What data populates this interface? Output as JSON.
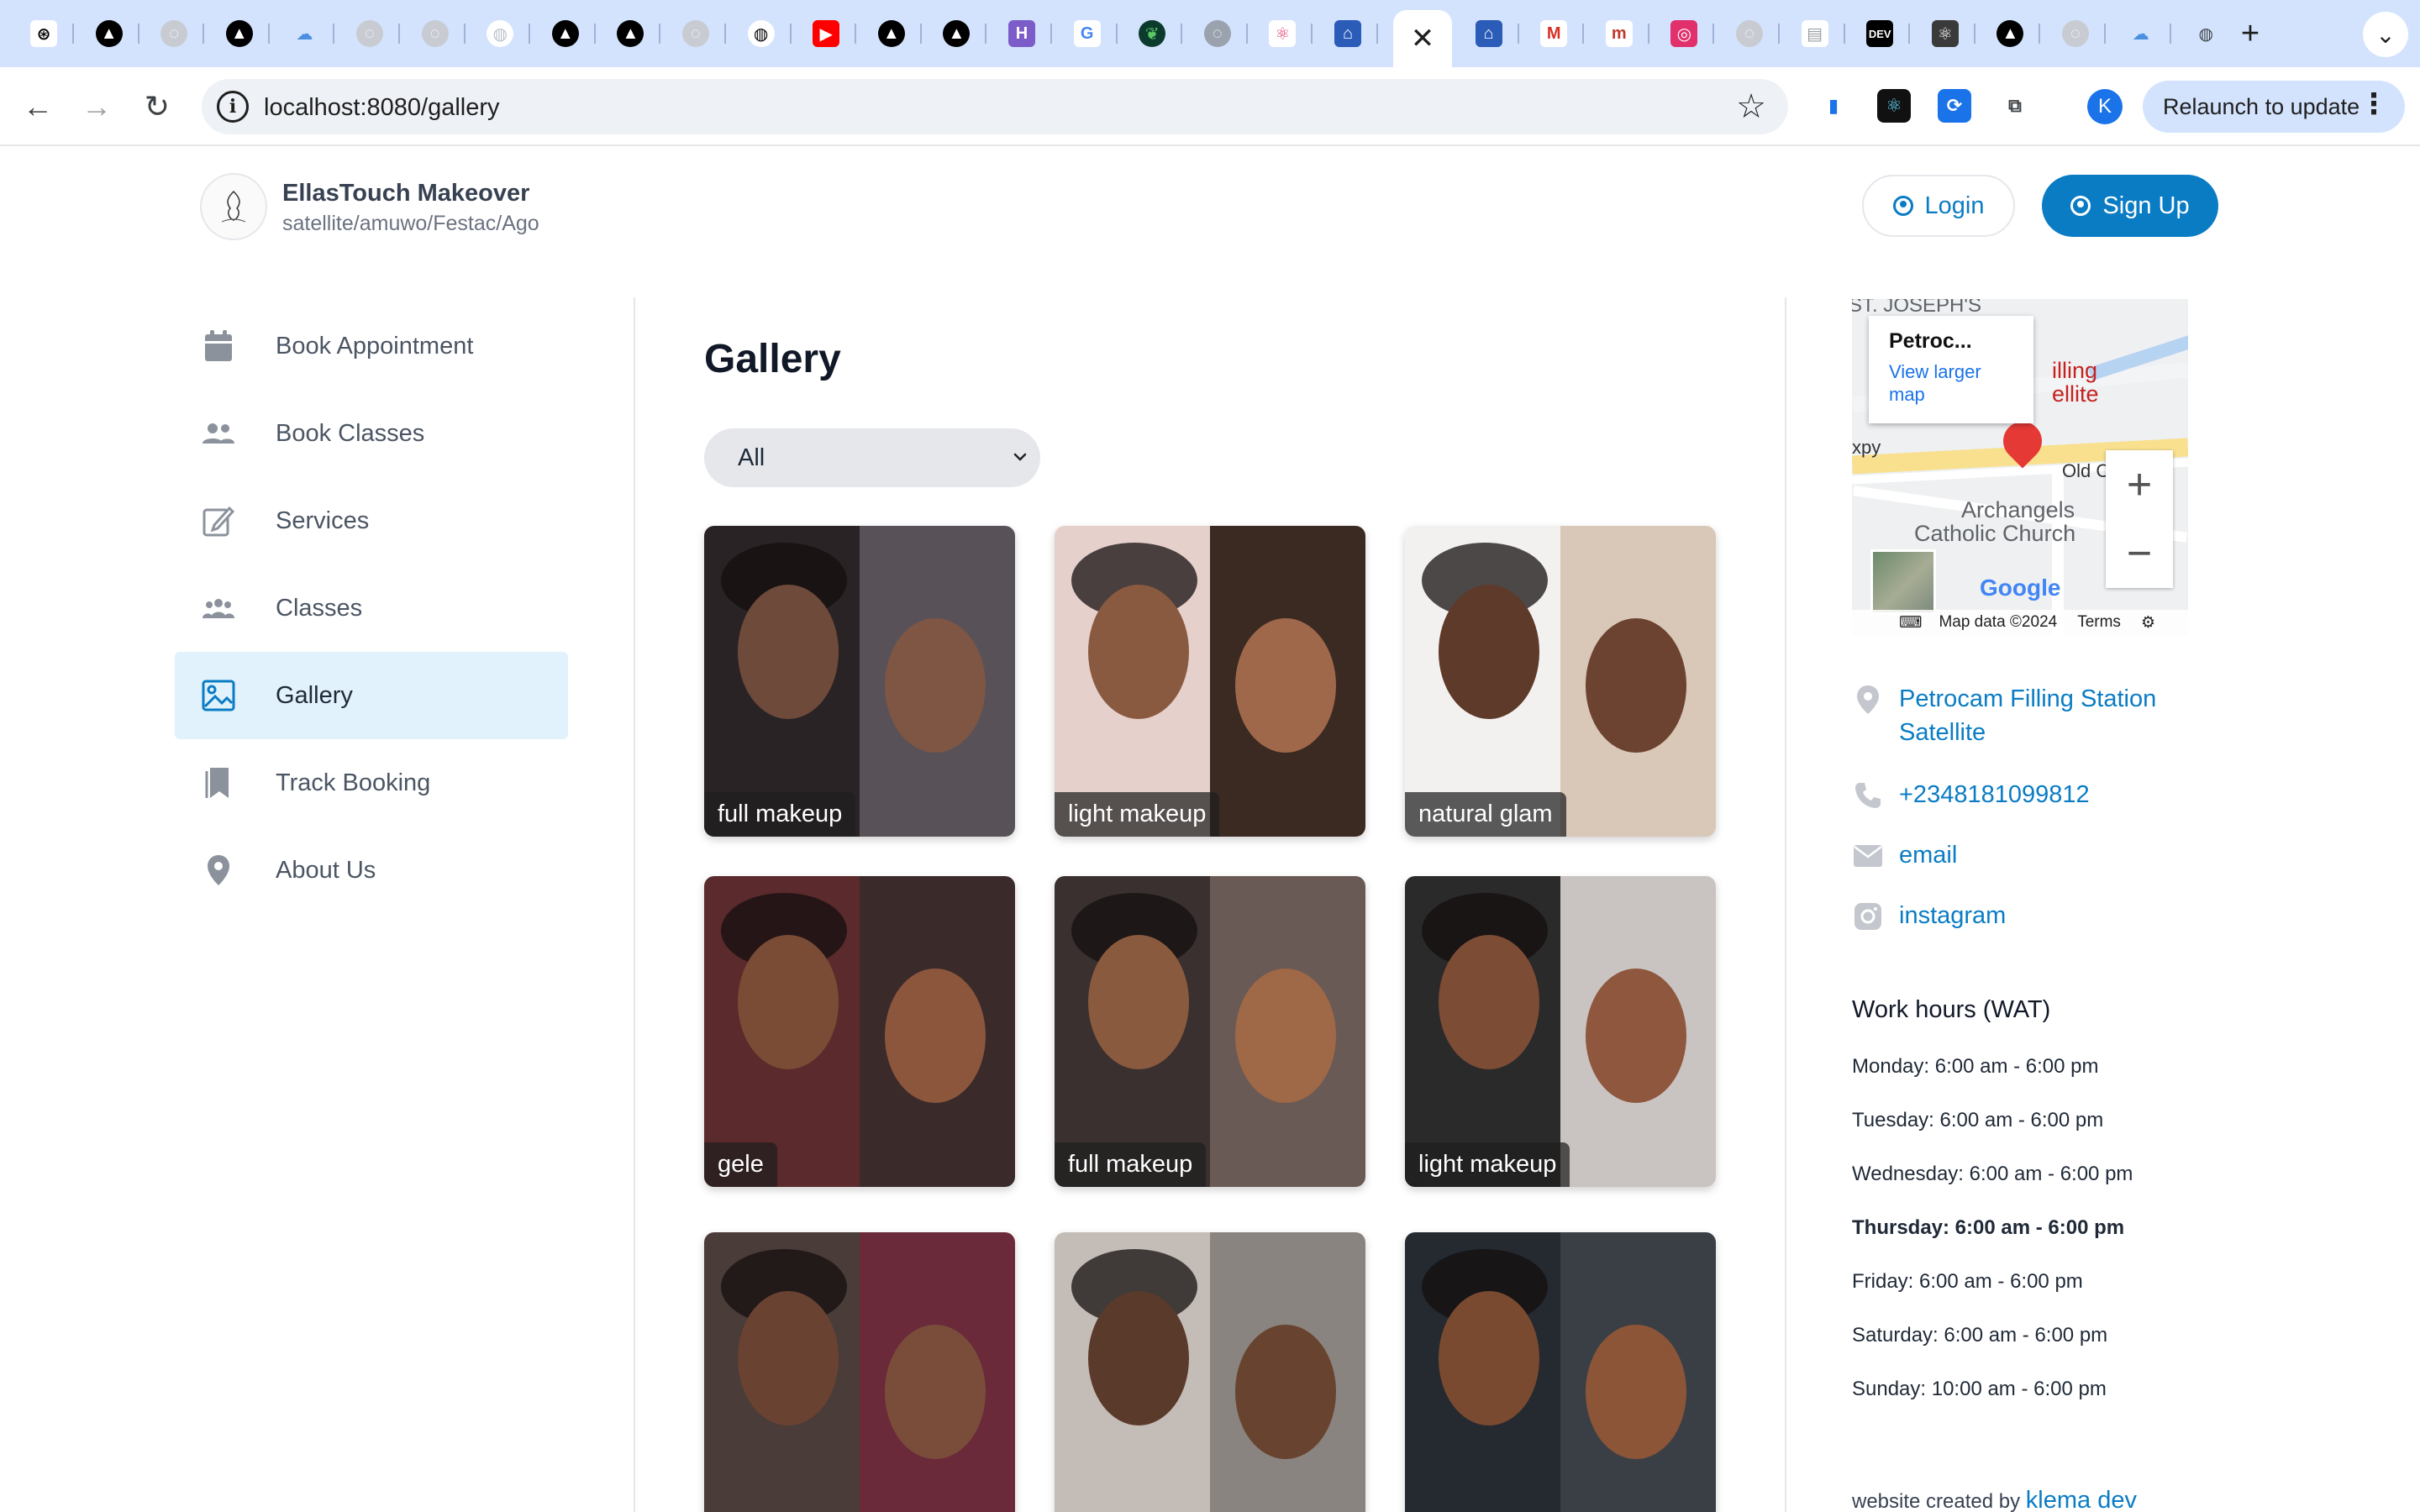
{
  "browser": {
    "tabs": [
      {
        "icon": "openai-icon",
        "glyph": "⊛",
        "bg": "#ffffff",
        "fg": "#000000"
      },
      {
        "icon": "vercel-icon",
        "glyph": "▲",
        "bg": "#000000",
        "fg": "#ffffff"
      },
      {
        "icon": "globe-icon",
        "glyph": "◌",
        "bg": "#c8ccd2",
        "fg": "#ffffff"
      },
      {
        "icon": "vercel-icon",
        "glyph": "▲",
        "bg": "#000000",
        "fg": "#ffffff"
      },
      {
        "icon": "cloud-icon",
        "glyph": "☁",
        "bg": "#d3e3fd",
        "fg": "#4a8fe0"
      },
      {
        "icon": "globe-icon",
        "glyph": "◌",
        "bg": "#c8ccd2",
        "fg": "#ffffff"
      },
      {
        "icon": "globe-icon",
        "glyph": "◌",
        "bg": "#c8ccd2",
        "fg": "#ffffff"
      },
      {
        "icon": "github-icon",
        "glyph": "◍",
        "bg": "#ffffff",
        "fg": "#b9c1cc"
      },
      {
        "icon": "vercel-icon",
        "glyph": "▲",
        "bg": "#000000",
        "fg": "#ffffff"
      },
      {
        "icon": "vercel-icon",
        "glyph": "▲",
        "bg": "#000000",
        "fg": "#ffffff"
      },
      {
        "icon": "globe-icon",
        "glyph": "◌",
        "bg": "#c8ccd2",
        "fg": "#ffffff"
      },
      {
        "icon": "github-icon",
        "glyph": "◍",
        "bg": "#ffffff",
        "fg": "#000000"
      },
      {
        "icon": "youtube-icon",
        "glyph": "▶",
        "bg": "#ff0000",
        "fg": "#ffffff"
      },
      {
        "icon": "vercel-icon",
        "glyph": "▲",
        "bg": "#000000",
        "fg": "#ffffff"
      },
      {
        "icon": "vercel-icon",
        "glyph": "▲",
        "bg": "#000000",
        "fg": "#ffffff"
      },
      {
        "icon": "heroku-icon",
        "glyph": "H",
        "bg": "#7b5cc9",
        "fg": "#ffffff"
      },
      {
        "icon": "google-icon",
        "glyph": "G",
        "bg": "#ffffff",
        "fg": "#4285f4"
      },
      {
        "icon": "mongodb-icon",
        "glyph": "❦",
        "bg": "#0c3b2e",
        "fg": "#59c764"
      },
      {
        "icon": "globe-icon",
        "glyph": "◌",
        "bg": "#9aa2ad",
        "fg": "#ffffff"
      },
      {
        "icon": "react-icon",
        "glyph": "⚛",
        "bg": "#ffffff",
        "fg": "#e0457b"
      },
      {
        "icon": "tab-app-icon",
        "glyph": "⌂",
        "bg": "#2a5cb8",
        "fg": "#ffffff"
      },
      {
        "icon": "tab-app-icon",
        "glyph": "⌂",
        "bg": "#2a5cb8",
        "fg": "#ffffff"
      },
      {
        "icon": "gmail-icon",
        "glyph": "M",
        "bg": "#ffffff",
        "fg": "#d93025"
      },
      {
        "icon": "medium-icon",
        "glyph": "m",
        "bg": "#ffffff",
        "fg": "#c0392b"
      },
      {
        "icon": "instagram-icon",
        "glyph": "◎",
        "bg": "#e1306c",
        "fg": "#ffffff"
      },
      {
        "icon": "globe-icon",
        "glyph": "◌",
        "bg": "#c8ccd2",
        "fg": "#ffffff"
      },
      {
        "icon": "document-icon",
        "glyph": "▤",
        "bg": "#ffffff",
        "fg": "#9aa0a6"
      },
      {
        "icon": "dev-icon",
        "glyph": "DEV",
        "bg": "#000000",
        "fg": "#ffffff"
      },
      {
        "icon": "react-icon",
        "glyph": "⚛",
        "bg": "#3a3a3a",
        "fg": "#ffffff"
      },
      {
        "icon": "vercel-icon",
        "glyph": "▲",
        "bg": "#000000",
        "fg": "#ffffff"
      },
      {
        "icon": "globe-icon",
        "glyph": "◌",
        "bg": "#c8ccd2",
        "fg": "#ffffff"
      },
      {
        "icon": "cloud-icon",
        "glyph": "☁",
        "bg": "#d3e3fd",
        "fg": "#4a8fe0"
      },
      {
        "icon": "globe-icon",
        "glyph": "◍",
        "bg": "#d3e3fd",
        "fg": "#3c4043"
      }
    ],
    "active_tab_close": "✕",
    "new_tab": "+",
    "tab_menu": "⌄",
    "back": "←",
    "forward": "→",
    "reload": "↻",
    "site_info": "i",
    "url": "localhost:8080/gallery",
    "star": "☆",
    "extensions": [
      {
        "icon": "extension-doc-icon",
        "glyph": "▮",
        "bg": "#ffffff",
        "fg": "#1a73e8"
      },
      {
        "icon": "extension-react-icon",
        "glyph": "⚛",
        "bg": "#111111",
        "fg": "#61dafb"
      },
      {
        "icon": "extension-sync-icon",
        "glyph": "⟳",
        "bg": "#1a73e8",
        "fg": "#ffffff"
      },
      {
        "icon": "extensions-puzzle-icon",
        "glyph": "⧉",
        "bg": "#ffffff",
        "fg": "#3c4043"
      }
    ],
    "profile_initial": "K",
    "relaunch_label": "Relaunch to update",
    "menu_dots": "⋮"
  },
  "header": {
    "brand_name": "EllasTouch Makeover",
    "brand_location": "satellite/amuwo/Festac/Ago",
    "login_label": "Login",
    "signup_label": "Sign Up",
    "accent": "#0a7cc4"
  },
  "sidebar": {
    "items": [
      {
        "label": "Book Appointment",
        "icon": "calendar-icon",
        "active": false
      },
      {
        "label": "Book Classes",
        "icon": "users-icon",
        "active": false
      },
      {
        "label": "Services",
        "icon": "edit-icon",
        "active": false
      },
      {
        "label": "Classes",
        "icon": "group-icon",
        "active": false
      },
      {
        "label": "Gallery",
        "icon": "image-icon",
        "active": true
      },
      {
        "label": "Track Booking",
        "icon": "bookmark-icon",
        "active": false
      },
      {
        "label": "About Us",
        "icon": "location-pin-icon",
        "active": false
      }
    ]
  },
  "gallery": {
    "title": "Gallery",
    "filter_value": "All",
    "items": [
      {
        "label": "full makeup",
        "left": "#2a2326",
        "right": "#585258",
        "skin": "#6e4a3a"
      },
      {
        "label": "light makeup",
        "left": "#e6d0cc",
        "right": "#3b2a22",
        "skin": "#8a5a40"
      },
      {
        "label": "natural glam",
        "left": "#f3f1ef",
        "right": "#d9c7b8",
        "skin": "#5e3a2a"
      },
      {
        "label": "gele",
        "left": "#5a2a2c",
        "right": "#3a2a2a",
        "skin": "#7a4b35"
      },
      {
        "label": "full makeup",
        "left": "#3a3030",
        "right": "#6a5a55",
        "skin": "#8a5a3e"
      },
      {
        "label": "light makeup",
        "left": "#2a2a2a",
        "right": "#c9c4c2",
        "skin": "#7c4c35"
      },
      {
        "label": "",
        "left": "#4a3c38",
        "right": "#6a2a3a",
        "skin": "#6a4232"
      },
      {
        "label": "",
        "left": "#c4bcb6",
        "right": "#8a8480",
        "skin": "#5a3a2a"
      },
      {
        "label": "",
        "left": "#252a30",
        "right": "#3a3f46",
        "skin": "#7a4a30"
      }
    ]
  },
  "map": {
    "popup_title": "Petroc...",
    "popup_link": "View larger map",
    "zoom_in": "+",
    "zoom_out": "−",
    "label_top": "ST. JOSEPH'S",
    "label_filling": "illing",
    "label_satellite": "ellite",
    "label_xpy": "xpy",
    "label_old": "Old C",
    "label_archangels": "Archangels",
    "label_church": "Catholic Church",
    "google_logo": "Google",
    "map_data": "Map data ©2024",
    "terms": "Terms",
    "keyboard": "⌨",
    "settings": "⚙"
  },
  "contact": {
    "address": "Petrocam Filling Station Satellite",
    "phone": "+2348181099812",
    "email": "email",
    "instagram": "instagram"
  },
  "hours": {
    "title": "Work hours (WAT)",
    "days": [
      {
        "text": "Monday: 6:00 am - 6:00 pm",
        "today": false
      },
      {
        "text": "Tuesday: 6:00 am - 6:00 pm",
        "today": false
      },
      {
        "text": "Wednesday: 6:00 am - 6:00 pm",
        "today": false
      },
      {
        "text": "Thursday: 6:00 am - 6:00 pm",
        "today": true
      },
      {
        "text": "Friday: 6:00 am - 6:00 pm",
        "today": false
      },
      {
        "text": "Saturday: 6:00 am - 6:00 pm",
        "today": false
      },
      {
        "text": "Sunday: 10:00 am - 6:00 pm",
        "today": false
      }
    ]
  },
  "footer": {
    "credit_prefix": "website created by",
    "credit_link": "klema dev"
  }
}
